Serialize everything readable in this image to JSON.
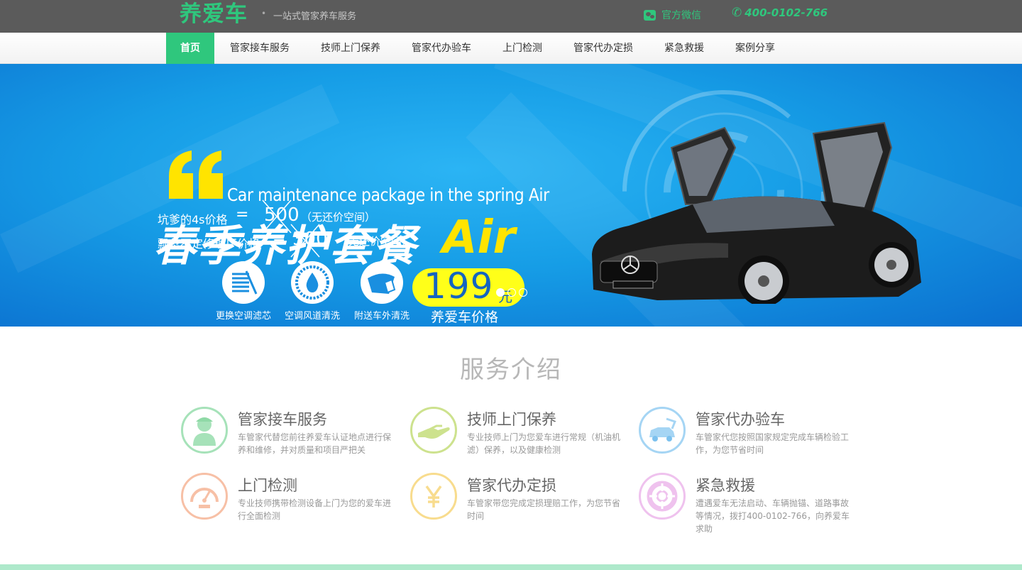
{
  "topbar": {
    "logo": "养爱车",
    "slogan": "一站式管家养车服务",
    "wechat_label": "官方微信",
    "phone": "400-0102-766"
  },
  "nav": {
    "items": [
      {
        "label": "首页",
        "active": true
      },
      {
        "label": "管家接车服务",
        "active": false
      },
      {
        "label": "技师上门保养",
        "active": false
      },
      {
        "label": "管家代办验车",
        "active": false
      },
      {
        "label": "上门检测",
        "active": false
      },
      {
        "label": "管家代办定损",
        "active": false
      },
      {
        "label": "紧急救援",
        "active": false
      },
      {
        "label": "案例分享",
        "active": false
      }
    ]
  },
  "banner": {
    "en_title": "Car maintenance package in the spring Air",
    "cn_title": "春季养护套餐",
    "cn_title_air": "Air",
    "price_4s_label": "坑爹的4s价格",
    "price_4s_value": "500",
    "price_4s_note": "（无还价空间）",
    "price_shop_label": "飘忽不定修理厂价格",
    "price_shop_value": "300",
    "price_shop_note": "（无还价空间）",
    "equals": "=",
    "price_new": "199",
    "price_unit": "元",
    "price_caption": "养爱车价格",
    "features": [
      {
        "label": "更换空调滤芯",
        "icon": "filter-icon"
      },
      {
        "label": "空调风道清洗",
        "icon": "water-drop-icon"
      },
      {
        "label": "附送车外清洗",
        "icon": "car-wash-icon"
      }
    ],
    "slide_count": 3,
    "active_slide": 1
  },
  "services": {
    "title": "服务介绍",
    "items": [
      {
        "title": "管家接车服务",
        "desc": "车管家代替您前往养爱车认证地点进行保养和维修，并对质量和项目严把关",
        "color": "#a6e2b9",
        "icon": "butler-icon"
      },
      {
        "title": "技师上门保养",
        "desc": "专业技师上门为您爱车进行常规（机油机滤）保养，以及健康检测",
        "color": "#cde28e",
        "icon": "hand-service-icon"
      },
      {
        "title": "管家代办验车",
        "desc": "车管家代您按照国家规定完成车辆检验工作，为您节省时间",
        "color": "#a5d5f4",
        "icon": "car-inspection-icon"
      },
      {
        "title": "上门检测",
        "desc": "专业技师携带检测设备上门为您的爱车进行全面检测",
        "color": "#f7c0a6",
        "icon": "gauge-icon"
      },
      {
        "title": "管家代办定损",
        "desc": "车管家带您完成定损理赔工作，为您节省时间",
        "color": "#f8dc8e",
        "icon": "yen-icon"
      },
      {
        "title": "紧急救援",
        "desc": "遭遇爱车无法启动、车辆抛锚、道路事故等情况，拨打400-0102-766，向养爱车求助",
        "color": "#efc2ee",
        "icon": "lifebuoy-icon"
      }
    ]
  }
}
